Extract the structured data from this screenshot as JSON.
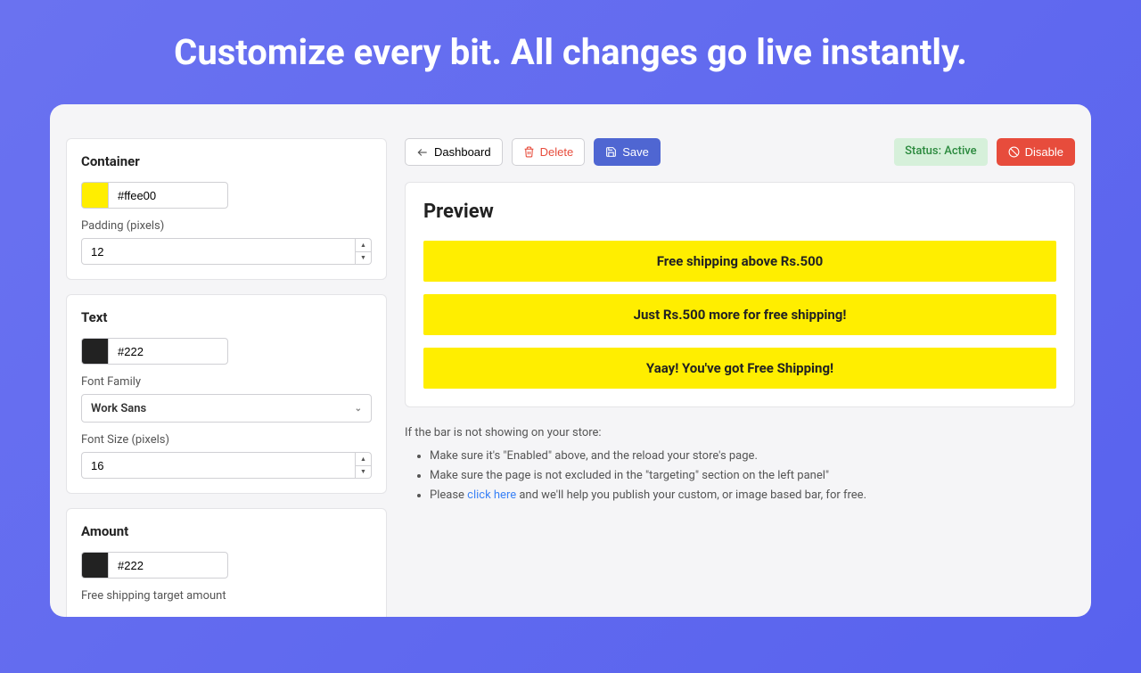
{
  "hero": "Customize every bit. All changes go live instantly.",
  "sidebar": {
    "container": {
      "title": "Container",
      "color": "#ffee00",
      "padding_label": "Padding (pixels)",
      "padding": "12"
    },
    "text": {
      "title": "Text",
      "color": "#222",
      "font_family_label": "Font Family",
      "font_family": "Work Sans",
      "font_size_label": "Font Size (pixels)",
      "font_size": "16"
    },
    "amount": {
      "title": "Amount",
      "color": "#222",
      "target_label": "Free shipping target amount"
    }
  },
  "toolbar": {
    "dashboard": "Dashboard",
    "delete": "Delete",
    "save": "Save",
    "status": "Status: Active",
    "disable": "Disable"
  },
  "preview": {
    "title": "Preview",
    "bars": [
      "Free shipping above Rs.500",
      "Just Rs.500 more for free shipping!",
      "Yaay! You've got Free Shipping!"
    ]
  },
  "help": {
    "intro": "If the bar is not showing on your store:",
    "items": [
      "Make sure it's \"Enabled\" above, and the reload your store's page.",
      "Make sure the page is not excluded in the \"targeting\" section on the left panel\""
    ],
    "last_a": "Please ",
    "last_link": "click here",
    "last_b": " and we'll help you publish your custom, or image based bar, for free."
  },
  "colors": {
    "container_swatch": "#ffee00",
    "text_swatch": "#222222",
    "amount_swatch": "#222222"
  }
}
